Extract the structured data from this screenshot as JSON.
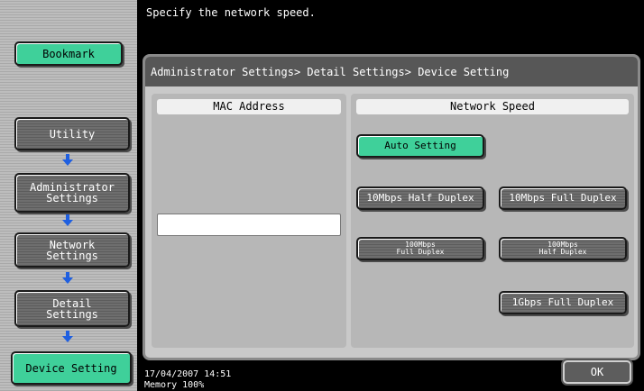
{
  "header": {
    "message": "Specify the network speed."
  },
  "sidebar": {
    "bookmark_label": "Bookmark",
    "items": [
      {
        "label": "Utility"
      },
      {
        "label": "Administrator\nSettings"
      },
      {
        "label": "Network\nSettings"
      },
      {
        "label": "Detail\nSettings"
      },
      {
        "label": "Device Setting"
      }
    ]
  },
  "breadcrumb": "Administrator Settings> Detail Settings> Device Setting",
  "mac_panel": {
    "title": "MAC Address",
    "value": ""
  },
  "speed_panel": {
    "title": "Network Speed",
    "options": {
      "auto": "Auto Setting",
      "half10": "10Mbps Half Duplex",
      "full10": "10Mbps Full Duplex",
      "full100": "100Mbps\nFull Duplex",
      "half100": "100Mbps\nHalf Duplex",
      "full1g": "1Gbps Full Duplex"
    },
    "selected": "Auto Setting"
  },
  "status": {
    "datetime": "17/04/2007    14:51",
    "memory": "Memory      100%"
  },
  "ok_label": "OK",
  "colors": {
    "accent_green": "#3fd09a",
    "arrow_blue": "#1f5fe0"
  }
}
